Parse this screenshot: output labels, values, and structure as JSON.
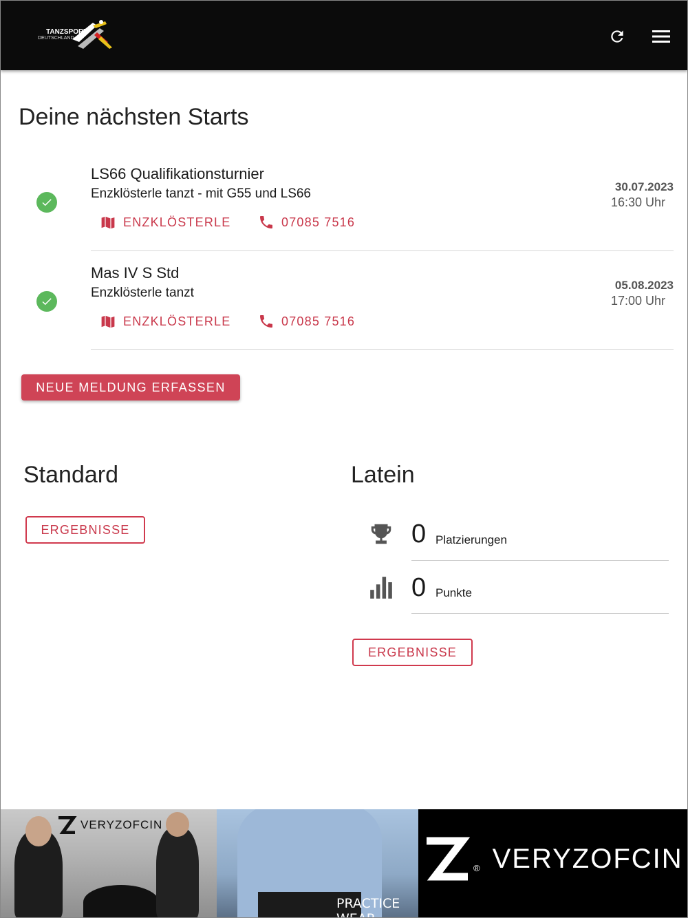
{
  "header": {
    "logo_line1": "TANZSPORT",
    "logo_line2": "DEUTSCHLAND"
  },
  "upcoming": {
    "title": "Deine nächsten Starts",
    "items": [
      {
        "name": "LS66 Qualifikationsturnier",
        "event": "Enzklösterle tanzt - mit G55 und LS66",
        "location_label": "ENZKLÖSTERLE",
        "phone_label": "07085 7516",
        "date": "30.07.2023",
        "time": "16:30 Uhr"
      },
      {
        "name": "Mas IV S Std",
        "event": "Enzklösterle tanzt",
        "location_label": "ENZKLÖSTERLE",
        "phone_label": "07085 7516",
        "date": "05.08.2023",
        "time": "17:00 Uhr"
      }
    ],
    "new_entry_label": "NEUE MELDUNG ERFASSEN"
  },
  "standard": {
    "title": "Standard",
    "results_label": "ERGEBNISSE"
  },
  "latein": {
    "title": "Latein",
    "placements_value": "0",
    "placements_label": "Platzierungen",
    "points_value": "0",
    "points_label": "Punkte",
    "results_label": "ERGEBNISSE"
  },
  "banner": {
    "brand_small": "VERYZOFCIN",
    "brand_big": "VERYZOFCIN",
    "practice_label": "PRACTICE WEAR",
    "registered": "®"
  },
  "colors": {
    "accent": "#cf4456",
    "check": "#5cb85c",
    "header_bg": "#0b0b0b"
  }
}
